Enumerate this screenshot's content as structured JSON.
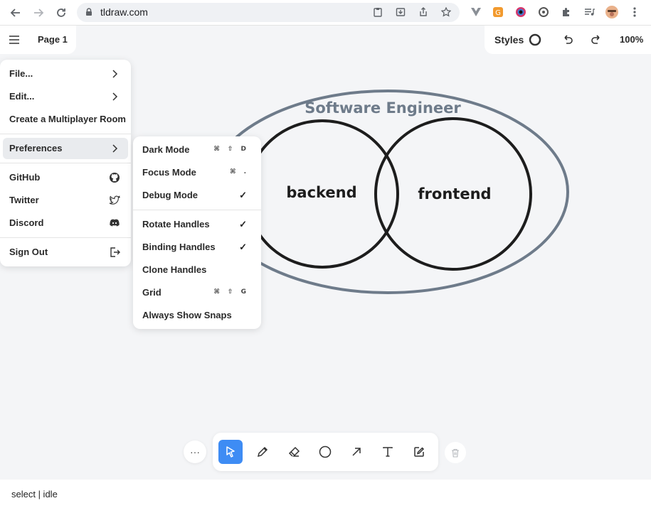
{
  "browser": {
    "url": "tldraw.com",
    "back_icon": "arrow-left-icon",
    "forward_icon": "arrow-right-icon",
    "reload_icon": "reload-icon"
  },
  "menu_bar": {
    "page_name": "Page 1"
  },
  "style_panel": {
    "label": "Styles",
    "zoom": "100%"
  },
  "main_menu": {
    "items": [
      {
        "label": "File...",
        "icon": "chevron-right-icon"
      },
      {
        "label": "Edit...",
        "icon": "chevron-right-icon"
      },
      {
        "label": "Create a Multiplayer Room"
      },
      {
        "label": "Preferences",
        "icon": "chevron-right-icon"
      },
      {
        "label": "GitHub",
        "icon": "github-icon"
      },
      {
        "label": "Twitter",
        "icon": "twitter-icon"
      },
      {
        "label": "Discord",
        "icon": "discord-icon"
      },
      {
        "label": "Sign Out",
        "icon": "sign-out-icon"
      }
    ]
  },
  "preferences_menu": {
    "items": [
      {
        "label": "Dark Mode",
        "shortcut": "⌘ ⇧ D"
      },
      {
        "label": "Focus Mode",
        "shortcut": "⌘ ."
      },
      {
        "label": "Debug Mode",
        "checked": "✓"
      },
      {
        "label": "Rotate Handles",
        "checked": "✓"
      },
      {
        "label": "Binding Handles",
        "checked": "✓"
      },
      {
        "label": "Clone Handles"
      },
      {
        "label": "Grid",
        "shortcut": "⌘ ⇧ G"
      },
      {
        "label": "Always Show Snaps"
      }
    ]
  },
  "canvas": {
    "outer_label": "Software Engineer",
    "left_label": "backend",
    "right_label": "frontend",
    "outer_color": "#6e7b8a",
    "circle_color": "#1d1d1d"
  },
  "toolbar": {
    "more": "···",
    "tools": [
      "select",
      "draw",
      "eraser",
      "ellipse",
      "arrow",
      "text",
      "sticky"
    ],
    "selected": "select",
    "accent": "#3e8cf4"
  },
  "status": {
    "text": "select | idle"
  }
}
